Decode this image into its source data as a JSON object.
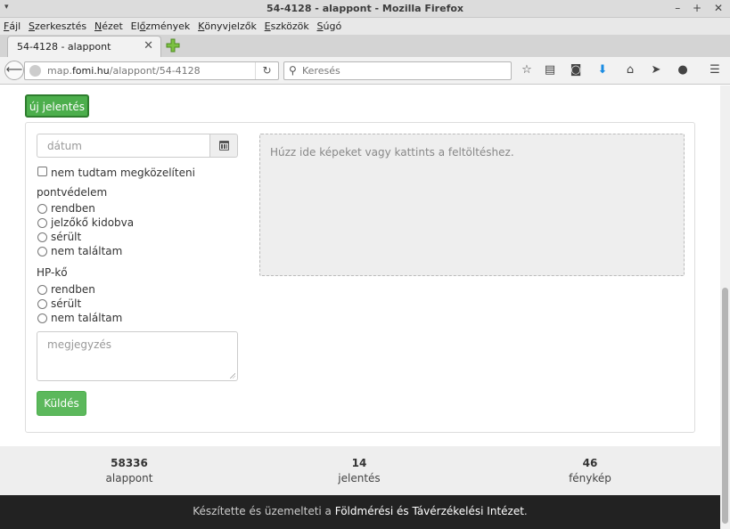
{
  "window": {
    "title": "54-4128 - alappont - Mozilla Firefox",
    "menu_glyph": "▾",
    "controls": {
      "minimize": "–",
      "maximize": "+",
      "close": "✕"
    }
  },
  "menubar": {
    "items": [
      {
        "accel": "F",
        "rest": "ájl"
      },
      {
        "accel": "S",
        "rest": "zerkesztés"
      },
      {
        "accel": "N",
        "rest": "ézet"
      },
      {
        "pre": "El",
        "accel": "ő",
        "rest": "zmények"
      },
      {
        "accel": "K",
        "rest": "önyvjelzők"
      },
      {
        "accel": "E",
        "rest": "szközök"
      },
      {
        "accel": "S",
        "rest": "úgó"
      }
    ]
  },
  "tab": {
    "label": "54-4128 - alappont",
    "close": "✕"
  },
  "navbar": {
    "url_prefix": "map.",
    "url_domain": "fomi.hu",
    "url_path": "/alappont/54-4128",
    "search_placeholder": "Keresés",
    "icons": [
      "star-icon",
      "reading-list-icon",
      "pocket-icon",
      "download-icon",
      "home-icon",
      "send-icon",
      "chat-icon",
      "hamburger-menu-icon"
    ]
  },
  "page": {
    "new_report_label": "új jelentés",
    "date_placeholder": "dátum",
    "cannot_approach_label": "nem tudtam megközelíteni",
    "pontvedelem": {
      "label": "pontvédelem",
      "options": [
        "rendben",
        "jelzőkő kidobva",
        "sérült",
        "nem találtam"
      ]
    },
    "hpko": {
      "label": "HP-kő",
      "options": [
        "rendben",
        "sérült",
        "nem találtam"
      ]
    },
    "note_placeholder": "megjegyzés",
    "submit_label": "Küldés",
    "dropzone_text": "Húzz ide képeket vagy kattints a feltöltéshez."
  },
  "stats": [
    {
      "value": "58336",
      "label": "alappont"
    },
    {
      "value": "14",
      "label": "jelentés"
    },
    {
      "value": "46",
      "label": "fénykép"
    }
  ],
  "footer": {
    "prefix": "Készítette és üzemelteti a ",
    "link": "Földmérési és Távérzékelési Intézet",
    "suffix": "."
  },
  "colors": {
    "primary_green": "#5cb85c",
    "footer_bg": "#222222",
    "stats_bg": "#eeeeee"
  }
}
